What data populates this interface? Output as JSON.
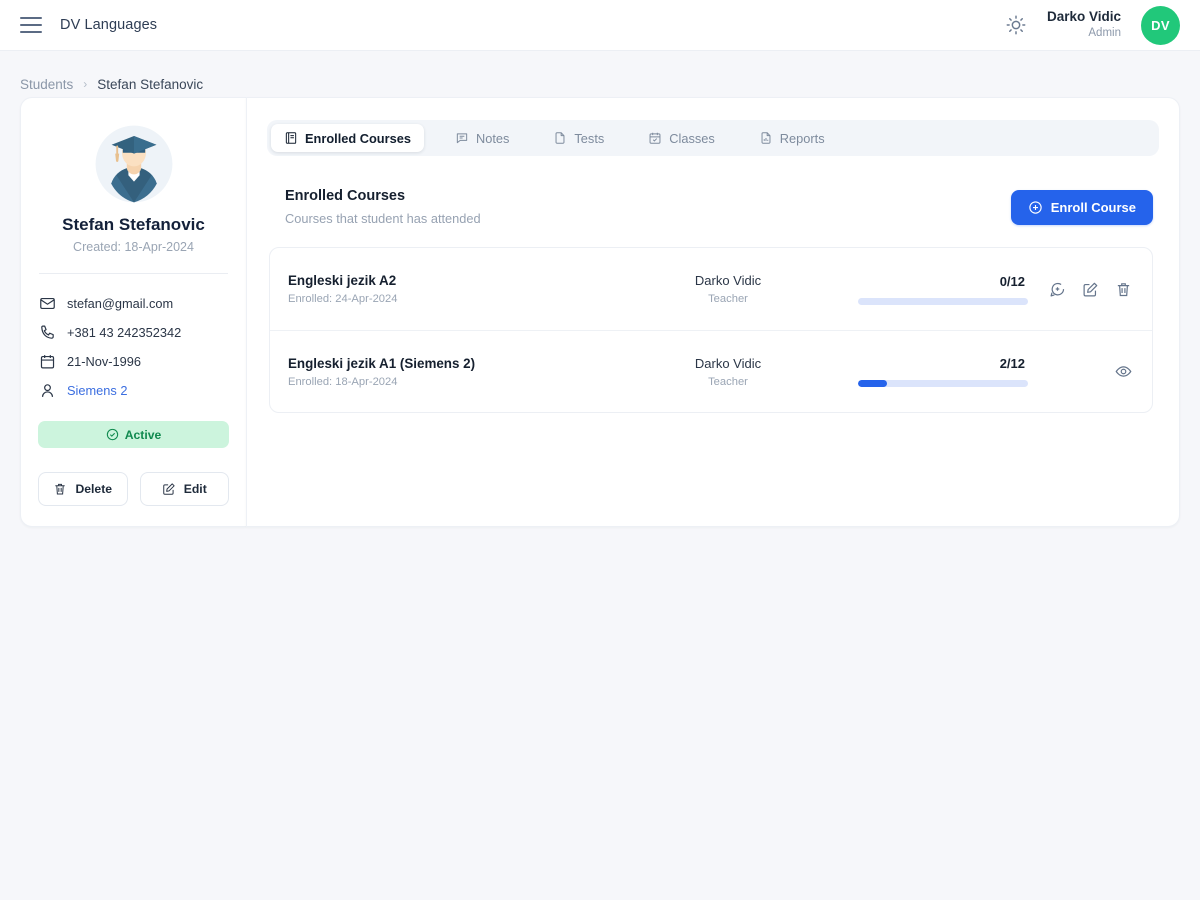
{
  "topbar": {
    "brand": "DV Languages",
    "menu_icon": "hamburger-icon",
    "theme_icon": "sun-icon",
    "user_name": "Darko Vidic",
    "user_role": "Admin",
    "user_initials": "DV"
  },
  "breadcrumb": {
    "parent": "Students",
    "separator": "›",
    "current": "Stefan Stefanovic"
  },
  "sidebar": {
    "avatar_alt": "graduate-avatar",
    "name": "Stefan Stefanovic",
    "created": "Created: 18-Apr-2024",
    "info": [
      {
        "icon": "mail-icon",
        "value": "stefan@gmail.com",
        "link": false
      },
      {
        "icon": "phone-icon",
        "value": "+381 43 242352342",
        "link": false
      },
      {
        "icon": "calendar-icon",
        "value": "21-Nov-1996",
        "link": false
      },
      {
        "icon": "user-icon",
        "value": "Siemens 2",
        "link": true
      }
    ],
    "status": {
      "label": "Active",
      "icon": "check-circle-icon",
      "bg": "#ccf4dd",
      "fg": "#108a4f"
    },
    "buttons": [
      {
        "label": "Delete",
        "icon": "trash-icon"
      },
      {
        "label": "Edit",
        "icon": "edit-icon"
      }
    ]
  },
  "main": {
    "tabs": [
      {
        "label": "Enrolled Courses",
        "icon": "book-icon",
        "active": true
      },
      {
        "label": "Notes",
        "icon": "message-icon",
        "active": false
      },
      {
        "label": "Tests",
        "icon": "file-icon",
        "active": false
      },
      {
        "label": "Classes",
        "icon": "calendar-check-icon",
        "active": false
      },
      {
        "label": "Reports",
        "icon": "report-icon",
        "active": false
      }
    ],
    "section": {
      "title": "Enrolled Courses",
      "subtitle": "Courses that student has attended",
      "enroll_button": "Enroll Course",
      "enroll_icon": "plus-circle-icon"
    },
    "courses": [
      {
        "title": "Engleski jezik A2",
        "enrolled": "Enrolled: 24-Apr-2024",
        "teacher": "Darko Vidic",
        "teacher_role": "Teacher",
        "count": "0/12",
        "progress_percent": 0,
        "actions": [
          "message-plus-icon",
          "edit-icon",
          "trash-icon"
        ]
      },
      {
        "title": "Engleski jezik A1 (Siemens 2)",
        "enrolled": "Enrolled: 18-Apr-2024",
        "teacher": "Darko Vidic",
        "teacher_role": "Teacher",
        "count": "2/12",
        "progress_percent": 17,
        "actions": [
          "eye-icon"
        ]
      }
    ]
  },
  "colors": {
    "accent": "#2563eb",
    "avatar_green": "#21c87a",
    "page_bg": "#f6f7fa",
    "progress_track": "#dbe4fb"
  }
}
